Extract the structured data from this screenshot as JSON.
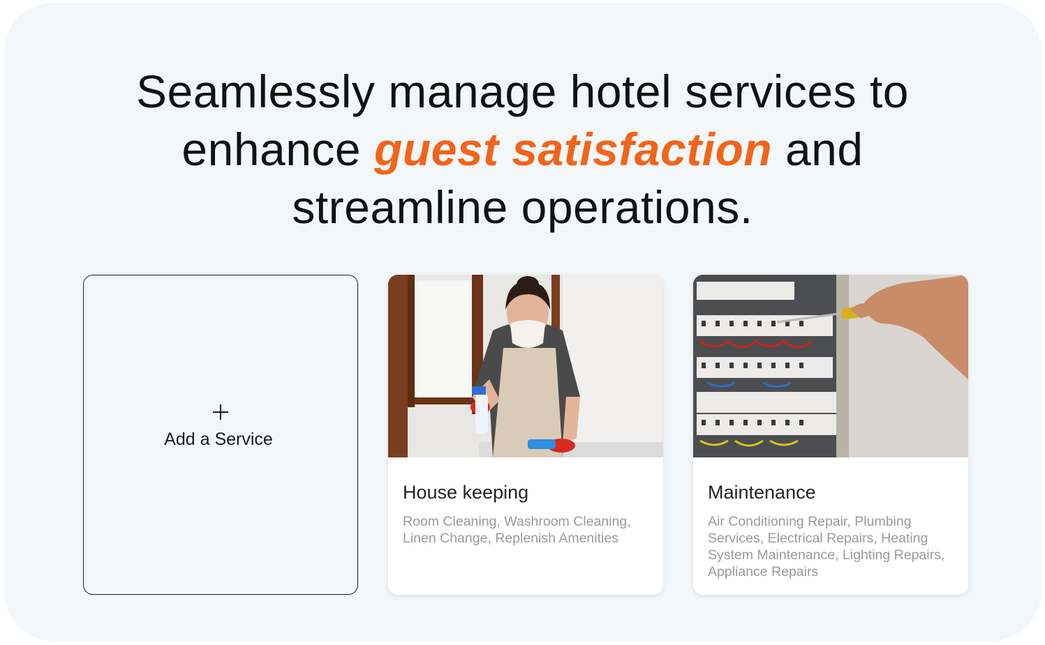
{
  "hero": {
    "line1": "Seamlessly manage hotel services to",
    "line2_before": "enhance ",
    "line2_accent": "guest satisfaction",
    "line2_after": " and",
    "line3": "streamline operations.",
    "accent_color": "#f26419"
  },
  "add_service": {
    "icon": "plus-icon",
    "label": "Add a Service"
  },
  "services": [
    {
      "title": "House keeping",
      "description": "Room Cleaning, Washroom Cleaning, Linen Change, Replenish Amenities",
      "image": "housekeeping-photo"
    },
    {
      "title": "Maintenance",
      "description": "Air Conditioning Repair, Plumbing Services, Electrical Repairs, Heating System Maintenance, Lighting Repairs, Appliance Repairs",
      "image": "maintenance-photo"
    }
  ]
}
